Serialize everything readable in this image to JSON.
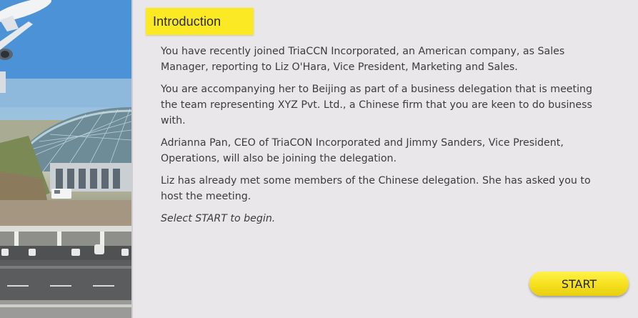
{
  "intro": {
    "title": "Introduction",
    "paragraphs": [
      "You have recently joined TriaCCN Incorporated, an American company, as Sales Manager, reporting to Liz O'Hara, Vice President, Marketing and Sales.",
      "You are accompanying her to Beijing as part of a business delegation that is meeting the team representing XYZ Pvt. Ltd., a Chinese firm that you are keen to do business with.",
      "Adrianna Pan, CEO of TriaCON Incorporated and Jimmy Sanders, Vice President, Operations, will also be joining the delegation.",
      "Liz has already met some members of the Chinese delegation. She has asked you to host the meeting."
    ],
    "instruction": "Select START to begin."
  },
  "start_button": {
    "label": "START"
  },
  "colors": {
    "heading_bg": "#fbe923",
    "button_bg": "#f6e01d",
    "page_bg": "#e9e7ea"
  }
}
